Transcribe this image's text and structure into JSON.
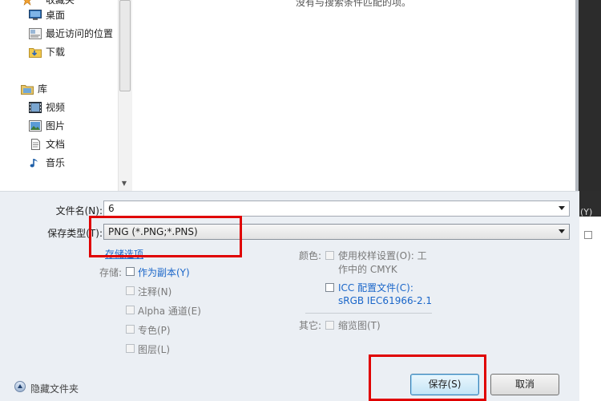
{
  "nav": {
    "items": [
      {
        "label": "收藏夹",
        "icon": "favorites-star-icon"
      },
      {
        "label": "桌面",
        "icon": "desktop-icon"
      },
      {
        "label": "最近访问的位置",
        "icon": "recent-places-icon"
      },
      {
        "label": "下载",
        "icon": "downloads-folder-icon"
      },
      {
        "label": "库",
        "icon": "libraries-icon"
      },
      {
        "label": "视频",
        "icon": "videos-icon"
      },
      {
        "label": "图片",
        "icon": "pictures-icon"
      },
      {
        "label": "文档",
        "icon": "documents-icon"
      },
      {
        "label": "音乐",
        "icon": "music-icon"
      }
    ]
  },
  "results": {
    "empty_message": "没有与搜索条件匹配的项。"
  },
  "form": {
    "filename_label": "文件名(N):",
    "filename_value": "6",
    "filetype_label": "保存类型(T):",
    "filetype_value": "PNG (*.PNG;*.PNS)",
    "save_options_link": "存储选项",
    "storage_label": "存储:",
    "as_copy": "作为副本(Y)",
    "annotations": "注释(N)",
    "alpha_channel": "Alpha 通道(E)",
    "spot_color": "专色(P)",
    "layers": "图层(L)",
    "color_label": "颜色:",
    "use_proof_line1": "使用校样设置(O): 工",
    "use_proof_line2": "作中的 CMYK",
    "icc_line1": "ICC 配置文件(C):",
    "icc_line2": "sRGB IEC61966-2.1",
    "other_label": "其它:",
    "thumbnail": "缩览图(T)",
    "side_text": "(Y)"
  },
  "footer": {
    "hide_folders": "隐藏文件夹",
    "save_button": "保存(S)",
    "cancel_button": "取消"
  },
  "colors": {
    "highlight": "#e00000",
    "link": "#1a66c9"
  }
}
